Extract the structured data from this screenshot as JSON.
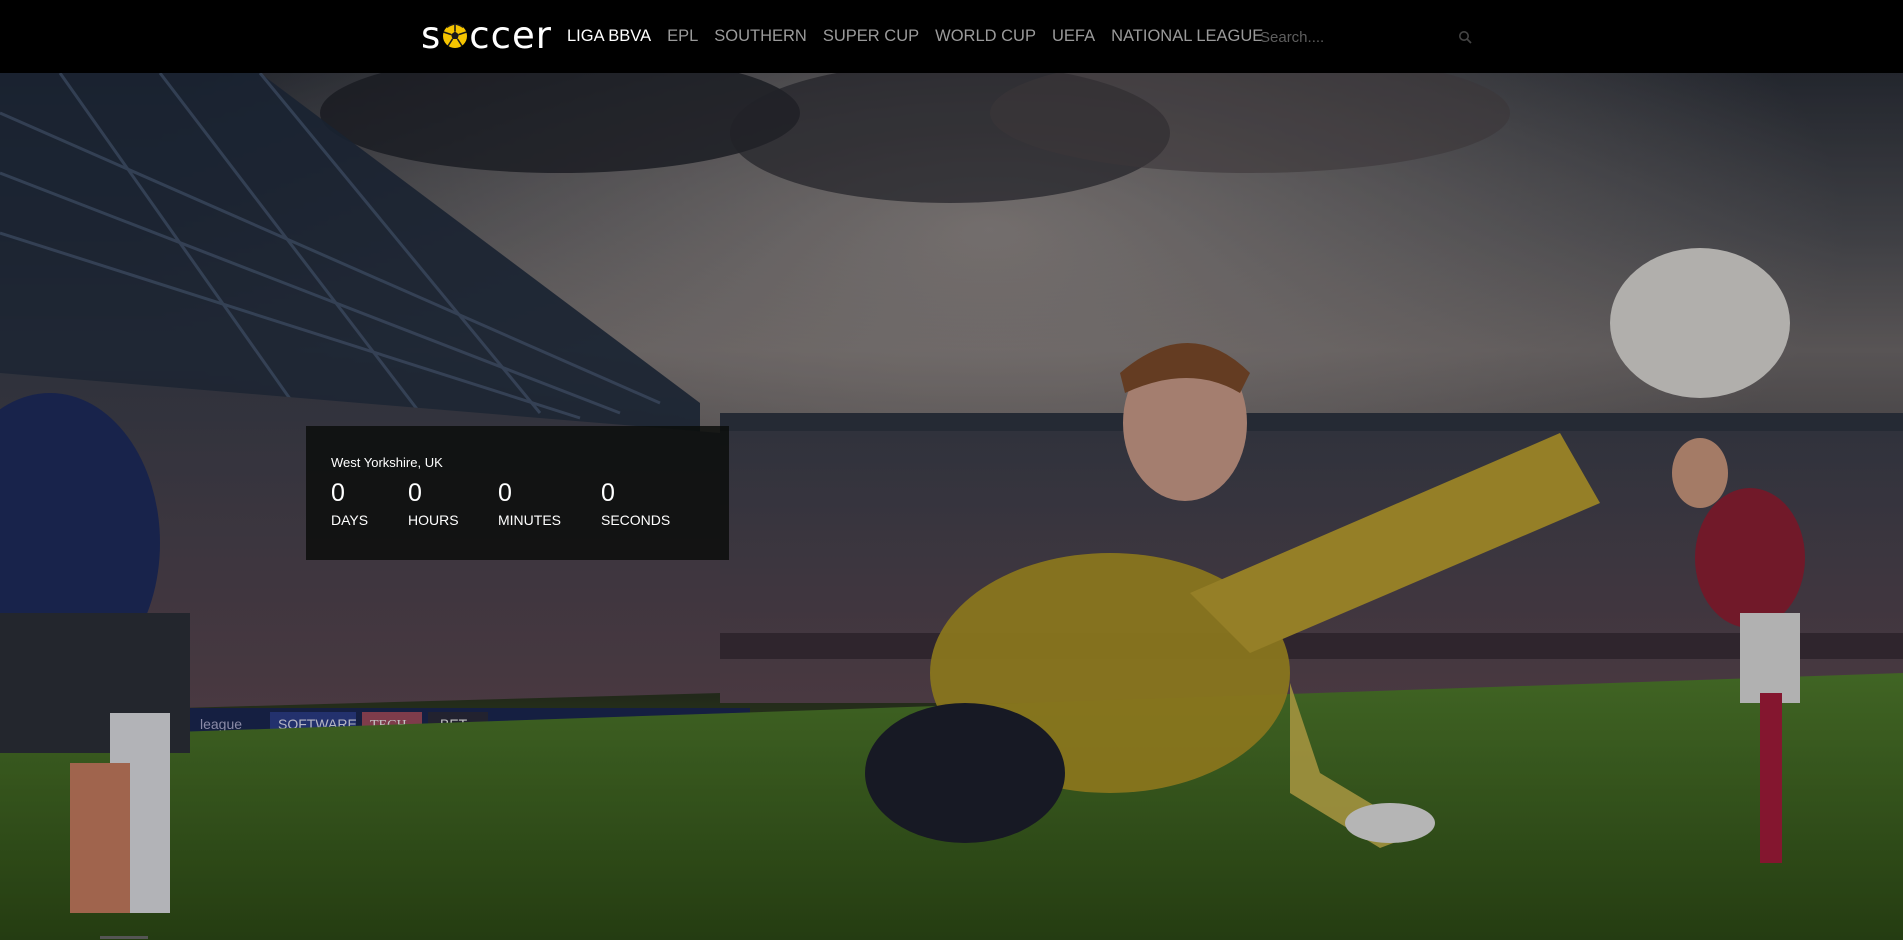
{
  "brand": {
    "logo_text_left": "s",
    "logo_text_right": "ccer"
  },
  "nav": {
    "items": [
      {
        "label": "LIGA BBVA",
        "active": true
      },
      {
        "label": "EPL",
        "active": false
      },
      {
        "label": "SOUTHERN",
        "active": false
      },
      {
        "label": "SUPER CUP",
        "active": false
      },
      {
        "label": "WORLD CUP",
        "active": false
      },
      {
        "label": "UEFA",
        "active": false
      },
      {
        "label": "NATIONAL LEAGUE",
        "active": false
      }
    ]
  },
  "search": {
    "placeholder": "Search....",
    "icon": "search-icon"
  },
  "countdown": {
    "location": "West Yorkshire, UK",
    "units": [
      {
        "value": "0",
        "label": "DAYS"
      },
      {
        "value": "0",
        "label": "HOURS"
      },
      {
        "value": "0",
        "label": "MINUTES"
      },
      {
        "value": "0",
        "label": "SECONDS"
      }
    ]
  },
  "hero": {
    "stadium_boards": [
      "league",
      "SOFTWARE",
      "TECH",
      "BET",
      "TECH",
      "BET"
    ]
  },
  "colors": {
    "topbar": "#000000",
    "nav_active": "#ffffff",
    "nav_inactive": "#9a9a9a",
    "logo_ball": "#f5c400",
    "countdown_bg": "#0a0c0a"
  }
}
